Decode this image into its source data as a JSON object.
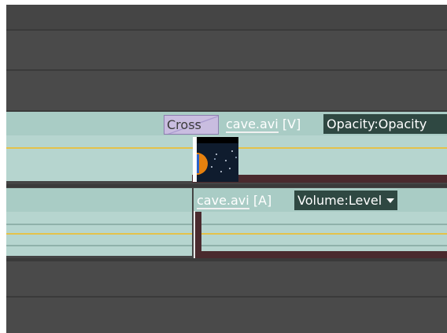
{
  "timeline": {
    "video_track": {
      "transition_label": "Cross",
      "clip_name": "cave.avi",
      "clip_type": "[V]",
      "param_label": "Opacity:Opacity"
    },
    "audio_track": {
      "clip_name": "cave.avi",
      "clip_type": "[A]",
      "param_label": "Volume:Level"
    }
  },
  "colors": {
    "track_bg": "#474747",
    "clip_fill": "#b6d5cf",
    "keyframe_line": "#e4c24a",
    "transition": "#c9bde0",
    "param_box": "#2f4842"
  },
  "icons": [
    "dropdown-caret-icon",
    "video-thumbnail"
  ]
}
